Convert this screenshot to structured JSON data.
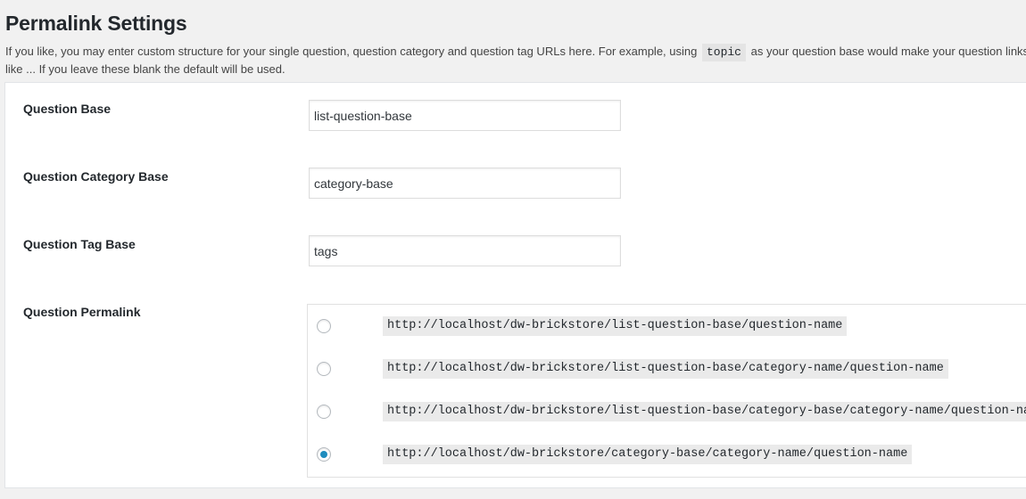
{
  "page": {
    "title": "Permalink Settings",
    "intro_before": "If you like, you may enter custom structure for your single question, question category and question tag URLs here. For example, using ",
    "intro_code": "topic",
    "intro_after": " as your question base would make your question links like ... If you leave these blank the default will be used."
  },
  "fields": {
    "question_base": {
      "label": "Question Base",
      "value": "list-question-base"
    },
    "category_base": {
      "label": "Question Category Base",
      "value": "category-base"
    },
    "tag_base": {
      "label": "Question Tag Base",
      "value": "tags"
    },
    "permalink": {
      "label": "Question Permalink",
      "selected_index": 3,
      "options": [
        "http://localhost/dw-brickstore/list-question-base/question-name",
        "http://localhost/dw-brickstore/list-question-base/category-name/question-name",
        "http://localhost/dw-brickstore/list-question-base/category-base/category-name/question-name",
        "http://localhost/dw-brickstore/category-base/category-name/question-name"
      ]
    }
  },
  "colors": {
    "radio_checked": "#1e8cbe",
    "page_background": "#f1f1f1",
    "code_background": "#eaeaea"
  }
}
